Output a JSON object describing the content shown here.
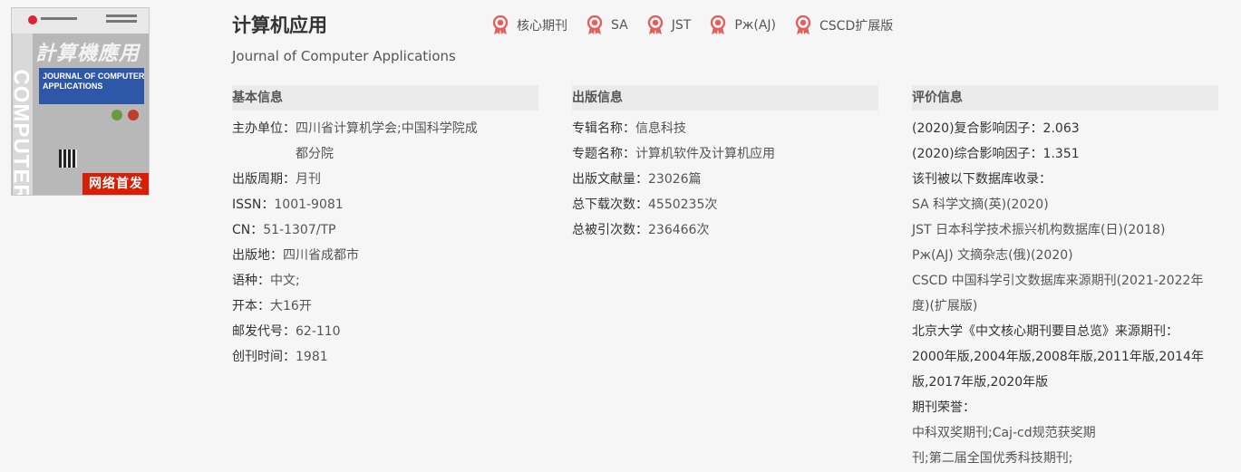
{
  "cover": {
    "side_text": "COMPUTER",
    "cn_title": "計算機應用",
    "en_title_line1": "JOURNAL OF COMPUTER",
    "en_title_line2": "APPLICATIONS",
    "first_publish_badge": "网络首发"
  },
  "header": {
    "title": "计算机应用",
    "subtitle": "Journal of Computer Applications",
    "badges": [
      "核心期刊",
      "SA",
      "JST",
      "Рж(AJ)",
      "CSCD扩展版"
    ]
  },
  "basic_info": {
    "heading": "基本信息",
    "rows": [
      {
        "k": "主办单位：",
        "v": "四川省计算机学会;中国科学院成",
        "v2": "都分院"
      },
      {
        "k": "出版周期：",
        "v": "月刊"
      },
      {
        "k": "ISSN：",
        "v": "1001-9081"
      },
      {
        "k": "CN：",
        "v": "51-1307/TP"
      },
      {
        "k": "出版地：",
        "v": "四川省成都市"
      },
      {
        "k": "语种：",
        "v": "中文;"
      },
      {
        "k": "开本：",
        "v": "大16开"
      },
      {
        "k": "邮发代号：",
        "v": "62-110"
      },
      {
        "k": "创刊时间：",
        "v": "1981"
      }
    ]
  },
  "publish_info": {
    "heading": "出版信息",
    "rows": [
      {
        "k": "专辑名称：",
        "v": "信息科技"
      },
      {
        "k": "专题名称：",
        "v": "计算机软件及计算机应用"
      },
      {
        "k": "出版文献量：",
        "v": "23026篇"
      },
      {
        "k": "总下载次数：",
        "v": "4550235次"
      },
      {
        "k": "总被引次数：",
        "v": "236466次"
      }
    ]
  },
  "evaluation_info": {
    "heading": "评价信息",
    "lines": [
      "(2020)复合影响因子：2.063",
      "(2020)综合影响因子：1.351",
      "该刊被以下数据库收录：",
      "SA 科学文摘(英)(2020)",
      "JST 日本科学技术振兴机构数据库(日)(2018)",
      "Рж(AJ) 文摘杂志(俄)(2020)",
      "CSCD 中国科学引文数据库来源期刊(2021-2022年",
      "度)(扩展版)",
      "北京大学《中文核心期刊要目总览》来源期刊：",
      "2000年版,2004年版,2008年版,2011年版,2014年",
      "版,2017年版,2020年版",
      "期刊荣誉：",
      "中科双奖期刊;Caj-cd规范获奖期",
      "刊;第二届全国优秀科技期刊;"
    ]
  },
  "colors": {
    "badge_icon": "#e0605f",
    "first_badge_bg": "#d81e06",
    "page_bg": "#f7f6f6",
    "section_head_bg": "#ebebeb"
  }
}
